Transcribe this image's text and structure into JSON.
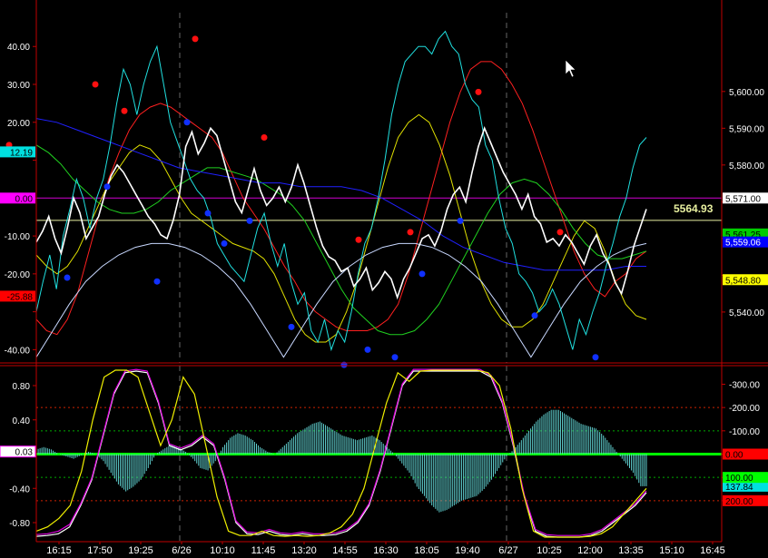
{
  "chart_data": [
    {
      "type": "line",
      "panel": "price",
      "left_axis": {
        "ticks": [
          40,
          30,
          20,
          10,
          0,
          -10,
          -20,
          -30,
          -40
        ],
        "labels": [
          "40.00",
          "30.00",
          "20.00",
          "",
          "0.00",
          "-10.00",
          "-20.00",
          "",
          "-40.00"
        ]
      },
      "right_axis": {
        "ticks": [
          5600,
          5590,
          5580,
          5570,
          5560,
          5550,
          5540
        ],
        "labels": [
          "5,600.00",
          "5,590.00",
          "5,580.00",
          "",
          "",
          "",
          "5,540.00"
        ]
      },
      "ylim_left": [
        -43.5,
        47
      ],
      "ylim_right": [
        5536.5,
        5609
      ],
      "horizontal_lines": [
        {
          "value": 5571.0,
          "color": "#d000d0"
        },
        {
          "value": 5564.93,
          "color": "#e8f0a0"
        }
      ],
      "annotation": "5564.93",
      "badges_left": [
        {
          "text": "12.19",
          "value": 12.19,
          "bg": "#00e0e0",
          "fg": "#000"
        },
        {
          "text": "0.00",
          "value": 0.0,
          "bg": "#ff00ff",
          "fg": "#000"
        },
        {
          "text": "-25.88",
          "value": -25.88,
          "bg": "#ff0000",
          "fg": "#000"
        }
      ],
      "badges_right": [
        {
          "text": "5,571.00",
          "value": 5571.0,
          "bg": "#ffffff",
          "fg": "#000"
        },
        {
          "text": "5,561.25",
          "value": 5561.25,
          "bg": "#00cc00",
          "fg": "#000"
        },
        {
          "text": "5,559.06",
          "value": 5559.06,
          "bg": "#0000ff",
          "fg": "#fff"
        },
        {
          "text": "5,548.80",
          "value": 5548.8,
          "bg": "#ffff00",
          "fg": "#000"
        }
      ],
      "price": [
        5559,
        5562,
        5566,
        5560,
        5556,
        5563,
        5571,
        5567,
        5560,
        5563,
        5566,
        5572,
        5577,
        5580,
        5578,
        5575,
        5572,
        5569,
        5566,
        5564,
        5561,
        5560,
        5565,
        5572,
        5585,
        5589,
        5583,
        5586,
        5590,
        5588,
        5582,
        5576,
        5570,
        5567,
        5573,
        5579,
        5573,
        5569,
        5571,
        5574,
        5570,
        5574,
        5580,
        5575,
        5569,
        5563,
        5558,
        5555,
        5554,
        5551,
        5552,
        5547,
        5549,
        5552,
        5546,
        5548,
        5551,
        5549,
        5544,
        5549,
        5552,
        5556,
        5560,
        5561,
        5558,
        5562,
        5568,
        5572,
        5574,
        5570,
        5578,
        5585,
        5590,
        5586,
        5582,
        5578,
        5575,
        5572,
        5568,
        5572,
        5566,
        5564,
        5559,
        5560,
        5558,
        5561,
        5559,
        5556,
        5553,
        5558,
        5561,
        5556,
        5553,
        5548,
        5545,
        5551,
        5558,
        5563,
        5568
      ],
      "cycle_cyan": [
        -30,
        -22,
        -15,
        -24,
        -10,
        -3,
        5,
        0,
        -8,
        0,
        5,
        14,
        25,
        34,
        30,
        22,
        30,
        36,
        40,
        30,
        20,
        15,
        10,
        5,
        2,
        0,
        -5,
        -12,
        -15,
        -18,
        -20,
        -22,
        -15,
        -8,
        -4,
        -12,
        -18,
        -12,
        -22,
        -28,
        -25,
        -35,
        -38,
        -32,
        -40,
        -35,
        -38,
        -30,
        -20,
        -12,
        -8,
        0,
        10,
        22,
        30,
        36,
        38,
        40,
        40,
        38,
        42,
        44,
        40,
        38,
        30,
        26,
        24,
        14,
        10,
        0,
        -8,
        -12,
        -20,
        -22,
        -25,
        -30,
        -28,
        -24,
        -28,
        -34,
        -40,
        -32,
        -36,
        -30,
        -25,
        -18,
        -12,
        -5,
        0,
        8,
        14,
        16
      ],
      "series": [
        {
          "name": "",
          "color": "#ff2020",
          "values": [
            -32,
            -35,
            -36,
            -32,
            -25,
            -15,
            -5,
            5,
            12,
            18,
            22,
            24,
            25,
            24,
            22,
            20,
            18,
            16,
            12,
            6,
            0,
            -4,
            -8,
            -13,
            -18,
            -22,
            -27,
            -30,
            -32,
            -34,
            -35,
            -35,
            -35,
            -34,
            -32,
            -28,
            -20,
            -10,
            0,
            10,
            20,
            28,
            34,
            36,
            36,
            34,
            30,
            25,
            18,
            10,
            2,
            -6,
            -14,
            -20,
            -24,
            -26,
            -22,
            -20,
            -16,
            -14
          ],
          "unit": "left"
        },
        {
          "name": "",
          "color": "#e0e000",
          "values": [
            -15,
            -18,
            -20,
            -18,
            -14,
            -8,
            -2,
            4,
            8,
            12,
            14,
            13,
            10,
            5,
            0,
            -4,
            -6,
            -8,
            -10,
            -12,
            -13,
            -14,
            -16,
            -20,
            -26,
            -32,
            -36,
            -38,
            -38,
            -36,
            -30,
            -22,
            -12,
            -2,
            8,
            16,
            20,
            22,
            20,
            14,
            6,
            -4,
            -14,
            -22,
            -28,
            -32,
            -34,
            -34,
            -32,
            -28,
            -22,
            -16,
            -10,
            -6,
            -8,
            -14,
            -22,
            -28,
            -31,
            -32
          ],
          "unit": "left"
        },
        {
          "name": "",
          "color": "#20d020",
          "values": [
            14,
            12,
            9,
            5,
            2,
            -1,
            -3,
            -4,
            -4,
            -3,
            -1,
            2,
            4,
            6,
            8,
            8,
            7,
            6,
            5,
            3,
            1,
            -2,
            -6,
            -12,
            -18,
            -24,
            -29,
            -32,
            -35,
            -36,
            -36,
            -35,
            -32,
            -28,
            -22,
            -16,
            -10,
            -4,
            1,
            4,
            5,
            4,
            1,
            -3,
            -8,
            -12,
            -15,
            -16,
            -16,
            -15,
            -14
          ],
          "unit": "left"
        },
        {
          "name": "",
          "color": "#2020ff",
          "values": [
            21,
            20,
            18,
            16,
            14,
            12,
            10,
            8,
            7,
            6,
            5,
            4,
            4,
            3,
            3,
            3,
            2,
            0,
            -3,
            -6,
            -10,
            -13,
            -15,
            -17,
            -18,
            -19,
            -19,
            -19,
            -19,
            -18,
            -18
          ],
          "unit": "left"
        },
        {
          "name": "",
          "color": "#c8d8ff",
          "values": [
            -42,
            -35,
            -28,
            -22,
            -18,
            -15,
            -13,
            -12,
            -12,
            -13,
            -15,
            -18,
            -22,
            -28,
            -35,
            -42,
            -35,
            -28,
            -22,
            -18,
            -15,
            -13,
            -12,
            -12,
            -13,
            -15,
            -18,
            -22,
            -28,
            -35,
            -42,
            -35,
            -28,
            -22,
            -18,
            -15,
            -13,
            -12
          ],
          "unit": "left"
        }
      ],
      "dots_red": [
        [
          10,
          14
        ],
        [
          105,
          30
        ],
        [
          137,
          23
        ],
        [
          215,
          42
        ],
        [
          291,
          16
        ],
        [
          395,
          -11
        ],
        [
          452,
          -9
        ],
        [
          527,
          28
        ],
        [
          617,
          -9
        ]
      ],
      "dots_blue": [
        [
          74,
          -21
        ],
        [
          118,
          3
        ],
        [
          173,
          -22
        ],
        [
          206,
          20
        ],
        [
          229,
          -4
        ],
        [
          247,
          -12
        ],
        [
          275,
          -6
        ],
        [
          321,
          -34
        ],
        [
          379,
          -44
        ],
        [
          405,
          -40
        ],
        [
          435,
          -42
        ],
        [
          465,
          -20
        ],
        [
          507,
          -6
        ],
        [
          589,
          -31
        ],
        [
          656,
          -42
        ]
      ],
      "dots_index_axis": "x in px along plot"
    },
    {
      "type": "line",
      "panel": "oscillator",
      "left_axis": {
        "ticks": [
          0.8,
          0.4,
          0.0,
          -0.4,
          -0.8
        ],
        "labels": [
          "0.80",
          "0.40",
          "",
          "-0.40",
          "-0.80"
        ]
      },
      "right_axis": {
        "ticks": [
          200,
          100,
          0,
          -100,
          -200,
          -300
        ],
        "labels": [
          "200.00",
          "100.00",
          "0.00",
          "-100.00",
          "-200.00",
          "-300.00"
        ]
      },
      "ylim_left": [
        -0.98,
        1.02
      ],
      "ylim_right": [
        -335,
        335
      ],
      "badges_left": [
        {
          "text": "0.03",
          "value": 0.03,
          "bg": "#ffffff",
          "fg": "#000",
          "border": "#ff00ff"
        }
      ],
      "badges_right": [
        {
          "text": "200.00",
          "value": 200,
          "bg": "#ff0000",
          "fg": "#000"
        },
        {
          "text": "137.84",
          "value": 137.84,
          "bg": "#00e0e0",
          "fg": "#000"
        },
        {
          "text": "100.00",
          "value": 100,
          "bg": "#00ff00",
          "fg": "#000"
        },
        {
          "text": "0.00",
          "value": 0,
          "bg": "#ff0000",
          "fg": "#000"
        }
      ],
      "reference_levels_right": [
        200,
        100,
        0,
        -100,
        -200
      ],
      "histogram": [
        -20,
        -30,
        -20,
        0,
        10,
        20,
        5,
        -10,
        0,
        30,
        80,
        130,
        160,
        140,
        110,
        60,
        0,
        -20,
        -40,
        -30,
        -10,
        20,
        60,
        70,
        30,
        -30,
        -70,
        -90,
        -80,
        -60,
        -30,
        -10,
        0,
        -30,
        -60,
        -90,
        -110,
        -130,
        -140,
        -120,
        -100,
        -80,
        -70,
        -60,
        -70,
        -80,
        -60,
        -30,
        0,
        40,
        80,
        140,
        180,
        220,
        250,
        240,
        220,
        200,
        190,
        180,
        150,
        110,
        60,
        10,
        -20,
        -60,
        -100,
        -140,
        -170,
        -190,
        -190,
        -170,
        -150,
        -130,
        -120,
        -110,
        -80,
        -40,
        0,
        40,
        80,
        138
      ],
      "series": [
        {
          "name": "",
          "color": "#ffffff",
          "values": [
            -0.96,
            -0.95,
            -0.93,
            -0.85,
            -0.6,
            -0.3,
            0.2,
            0.7,
            0.95,
            0.97,
            0.95,
            0.6,
            0.1,
            0.05,
            0.1,
            0.2,
            0.1,
            -0.3,
            -0.8,
            -0.93,
            -0.94,
            -0.9,
            -0.94,
            -0.95,
            -0.93,
            -0.95,
            -0.95,
            -0.94,
            -0.9,
            -0.8,
            -0.6,
            -0.2,
            0.3,
            0.8,
            0.97,
            0.97,
            0.97,
            0.97,
            0.97,
            0.97,
            0.97,
            0.9,
            0.6,
            0.1,
            -0.5,
            -0.9,
            -0.96,
            -0.97,
            -0.97,
            -0.97,
            -0.95,
            -0.9,
            -0.8,
            -0.7,
            -0.6,
            -0.45
          ]
        },
        {
          "name": "",
          "color": "#e000e0",
          "values": [
            -0.94,
            -0.93,
            -0.9,
            -0.82,
            -0.58,
            -0.28,
            0.22,
            0.72,
            0.97,
            0.99,
            0.97,
            0.62,
            0.12,
            0.07,
            0.12,
            0.22,
            0.12,
            -0.28,
            -0.78,
            -0.91,
            -0.92,
            -0.88,
            -0.92,
            -0.93,
            -0.91,
            -0.93,
            -0.93,
            -0.92,
            -0.88,
            -0.78,
            -0.58,
            -0.18,
            0.32,
            0.82,
            0.99,
            0.99,
            0.99,
            0.99,
            0.99,
            0.99,
            0.99,
            0.92,
            0.62,
            0.12,
            -0.48,
            -0.88,
            -0.94,
            -0.95,
            -0.95,
            -0.95,
            -0.93,
            -0.88,
            -0.78,
            -0.68,
            -0.58,
            -0.43
          ]
        },
        {
          "name": "",
          "color": "#f0f000",
          "values": [
            -0.9,
            -0.85,
            -0.75,
            -0.6,
            -0.2,
            0.4,
            0.9,
            0.98,
            0.98,
            0.9,
            0.5,
            0.1,
            0.4,
            0.9,
            0.7,
            0.1,
            -0.5,
            -0.9,
            -0.95,
            -0.95,
            -0.9,
            -0.95,
            -0.96,
            -0.95,
            -0.96,
            -0.95,
            -0.92,
            -0.85,
            -0.7,
            -0.4,
            0.1,
            0.6,
            0.95,
            0.85,
            0.97,
            0.98,
            0.98,
            0.98,
            0.98,
            0.98,
            0.95,
            0.8,
            0.3,
            -0.4,
            -0.9,
            -0.97,
            -0.97,
            -0.97,
            -0.97,
            -0.96,
            -0.93,
            -0.85,
            -0.7,
            -0.55,
            -0.4
          ]
        }
      ]
    }
  ],
  "x_axis": {
    "labels": [
      "16:15",
      "17:50",
      "19:25",
      "6/26",
      "10:10",
      "11:45",
      "13:20",
      "14:55",
      "16:30",
      "18:05",
      "19:40",
      "6/27",
      "10:25",
      "12:00",
      "13:35",
      "15:10",
      "16:45"
    ],
    "day_separators": [
      "6/26",
      "6/27"
    ]
  },
  "colors": {
    "background": "#000000",
    "frame": "#c00000",
    "grid": "#aa0000",
    "price_line": "#ffffff",
    "cycle_line": "#20e0e0",
    "histogram": "#60d0d0",
    "zero_line": "#00ff00"
  }
}
